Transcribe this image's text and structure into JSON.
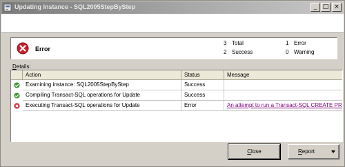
{
  "window": {
    "title": "Updating Instance - SQL2005StepByStep",
    "minimize": "_",
    "maximize": "□",
    "close": "×"
  },
  "summary": {
    "status": "Error",
    "total_count": "3",
    "total_label": "Total",
    "success_count": "2",
    "success_label": "Success",
    "error_count": "1",
    "error_label": "Error",
    "warning_count": "0",
    "warning_label": "Warning"
  },
  "details": {
    "label_underlined": "D",
    "label_rest": "etails:",
    "columns": [
      "Action",
      "Status",
      "Message"
    ],
    "rows": [
      {
        "action": "Examining instance: SQL2005StepByStep",
        "status": "Success",
        "message": "",
        "icon": "success-icon"
      },
      {
        "action": "Compiling Transact-SQL operations for Update",
        "status": "Success",
        "message": "",
        "icon": "success-icon"
      },
      {
        "action": "Executing Transact-SQL operations for Update",
        "status": "Error",
        "message": "An attempt to run a Transact-SQL CREATE PRO",
        "icon": "error-icon"
      }
    ]
  },
  "buttons": {
    "close_underlined": "C",
    "close_rest": "lose",
    "report_underlined": "R",
    "report_rest": "eport"
  },
  "colors": {
    "success": "#3a9a2a",
    "error": "#c8202a",
    "link": "#800080"
  }
}
